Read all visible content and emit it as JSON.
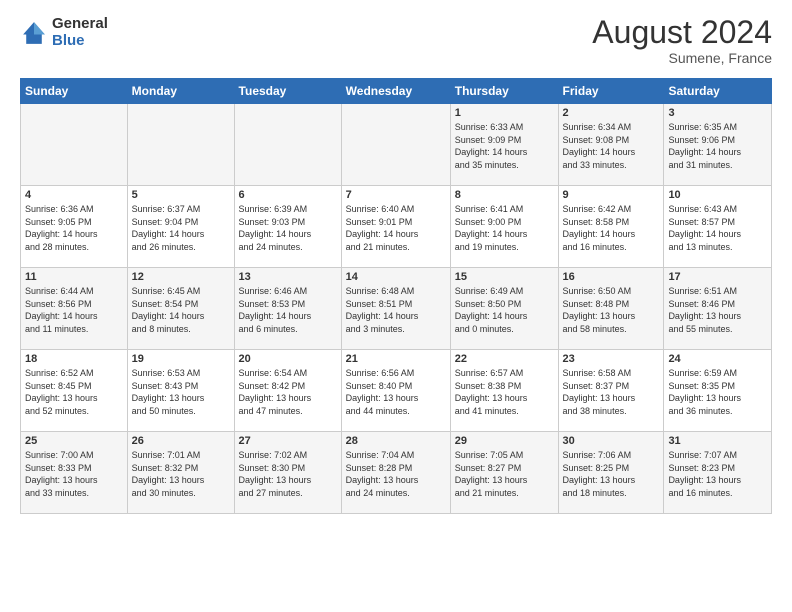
{
  "logo": {
    "general": "General",
    "blue": "Blue"
  },
  "title": "August 2024",
  "location": "Sumene, France",
  "days_of_week": [
    "Sunday",
    "Monday",
    "Tuesday",
    "Wednesday",
    "Thursday",
    "Friday",
    "Saturday"
  ],
  "weeks": [
    [
      {
        "day": "",
        "info": ""
      },
      {
        "day": "",
        "info": ""
      },
      {
        "day": "",
        "info": ""
      },
      {
        "day": "",
        "info": ""
      },
      {
        "day": "1",
        "info": "Sunrise: 6:33 AM\nSunset: 9:09 PM\nDaylight: 14 hours\nand 35 minutes."
      },
      {
        "day": "2",
        "info": "Sunrise: 6:34 AM\nSunset: 9:08 PM\nDaylight: 14 hours\nand 33 minutes."
      },
      {
        "day": "3",
        "info": "Sunrise: 6:35 AM\nSunset: 9:06 PM\nDaylight: 14 hours\nand 31 minutes."
      }
    ],
    [
      {
        "day": "4",
        "info": "Sunrise: 6:36 AM\nSunset: 9:05 PM\nDaylight: 14 hours\nand 28 minutes."
      },
      {
        "day": "5",
        "info": "Sunrise: 6:37 AM\nSunset: 9:04 PM\nDaylight: 14 hours\nand 26 minutes."
      },
      {
        "day": "6",
        "info": "Sunrise: 6:39 AM\nSunset: 9:03 PM\nDaylight: 14 hours\nand 24 minutes."
      },
      {
        "day": "7",
        "info": "Sunrise: 6:40 AM\nSunset: 9:01 PM\nDaylight: 14 hours\nand 21 minutes."
      },
      {
        "day": "8",
        "info": "Sunrise: 6:41 AM\nSunset: 9:00 PM\nDaylight: 14 hours\nand 19 minutes."
      },
      {
        "day": "9",
        "info": "Sunrise: 6:42 AM\nSunset: 8:58 PM\nDaylight: 14 hours\nand 16 minutes."
      },
      {
        "day": "10",
        "info": "Sunrise: 6:43 AM\nSunset: 8:57 PM\nDaylight: 14 hours\nand 13 minutes."
      }
    ],
    [
      {
        "day": "11",
        "info": "Sunrise: 6:44 AM\nSunset: 8:56 PM\nDaylight: 14 hours\nand 11 minutes."
      },
      {
        "day": "12",
        "info": "Sunrise: 6:45 AM\nSunset: 8:54 PM\nDaylight: 14 hours\nand 8 minutes."
      },
      {
        "day": "13",
        "info": "Sunrise: 6:46 AM\nSunset: 8:53 PM\nDaylight: 14 hours\nand 6 minutes."
      },
      {
        "day": "14",
        "info": "Sunrise: 6:48 AM\nSunset: 8:51 PM\nDaylight: 14 hours\nand 3 minutes."
      },
      {
        "day": "15",
        "info": "Sunrise: 6:49 AM\nSunset: 8:50 PM\nDaylight: 14 hours\nand 0 minutes."
      },
      {
        "day": "16",
        "info": "Sunrise: 6:50 AM\nSunset: 8:48 PM\nDaylight: 13 hours\nand 58 minutes."
      },
      {
        "day": "17",
        "info": "Sunrise: 6:51 AM\nSunset: 8:46 PM\nDaylight: 13 hours\nand 55 minutes."
      }
    ],
    [
      {
        "day": "18",
        "info": "Sunrise: 6:52 AM\nSunset: 8:45 PM\nDaylight: 13 hours\nand 52 minutes."
      },
      {
        "day": "19",
        "info": "Sunrise: 6:53 AM\nSunset: 8:43 PM\nDaylight: 13 hours\nand 50 minutes."
      },
      {
        "day": "20",
        "info": "Sunrise: 6:54 AM\nSunset: 8:42 PM\nDaylight: 13 hours\nand 47 minutes."
      },
      {
        "day": "21",
        "info": "Sunrise: 6:56 AM\nSunset: 8:40 PM\nDaylight: 13 hours\nand 44 minutes."
      },
      {
        "day": "22",
        "info": "Sunrise: 6:57 AM\nSunset: 8:38 PM\nDaylight: 13 hours\nand 41 minutes."
      },
      {
        "day": "23",
        "info": "Sunrise: 6:58 AM\nSunset: 8:37 PM\nDaylight: 13 hours\nand 38 minutes."
      },
      {
        "day": "24",
        "info": "Sunrise: 6:59 AM\nSunset: 8:35 PM\nDaylight: 13 hours\nand 36 minutes."
      }
    ],
    [
      {
        "day": "25",
        "info": "Sunrise: 7:00 AM\nSunset: 8:33 PM\nDaylight: 13 hours\nand 33 minutes."
      },
      {
        "day": "26",
        "info": "Sunrise: 7:01 AM\nSunset: 8:32 PM\nDaylight: 13 hours\nand 30 minutes."
      },
      {
        "day": "27",
        "info": "Sunrise: 7:02 AM\nSunset: 8:30 PM\nDaylight: 13 hours\nand 27 minutes."
      },
      {
        "day": "28",
        "info": "Sunrise: 7:04 AM\nSunset: 8:28 PM\nDaylight: 13 hours\nand 24 minutes."
      },
      {
        "day": "29",
        "info": "Sunrise: 7:05 AM\nSunset: 8:27 PM\nDaylight: 13 hours\nand 21 minutes."
      },
      {
        "day": "30",
        "info": "Sunrise: 7:06 AM\nSunset: 8:25 PM\nDaylight: 13 hours\nand 18 minutes."
      },
      {
        "day": "31",
        "info": "Sunrise: 7:07 AM\nSunset: 8:23 PM\nDaylight: 13 hours\nand 16 minutes."
      }
    ]
  ]
}
